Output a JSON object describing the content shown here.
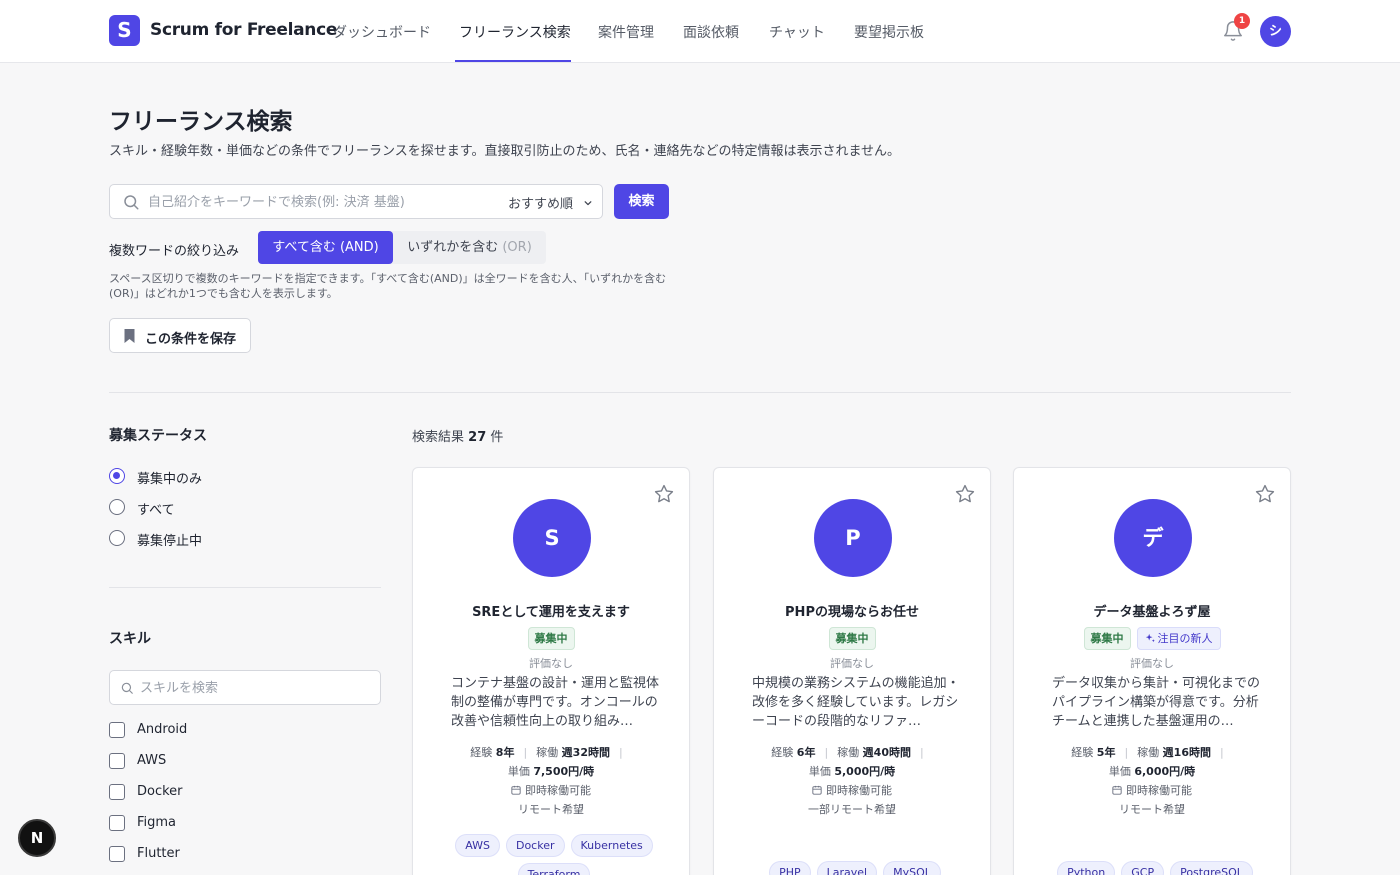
{
  "app": {
    "logo_letter": "S",
    "name": "Scrum for Freelance"
  },
  "nav": {
    "items": [
      {
        "label": "ダッシュボード"
      },
      {
        "label": "フリーランス検索"
      },
      {
        "label": "案件管理"
      },
      {
        "label": "面談依頼"
      },
      {
        "label": "チャット"
      },
      {
        "label": "要望掲示板"
      }
    ],
    "active": "フリーランス検索",
    "notification_count": "1",
    "user_initial": "シ"
  },
  "page": {
    "title": "フリーランス検索",
    "description": "スキル・経験年数・単価などの条件でフリーランスを探せます。直接取引防止のため、氏名・連絡先などの特定情報は表示されません。"
  },
  "search": {
    "placeholder": "自己紹介をキーワードで検索(例: 決済 基盤)",
    "value": "",
    "sort_selected": "おすすめ順",
    "button_label": "検索"
  },
  "multiword": {
    "label": "複数ワードの絞り込み",
    "and_label": "すべて含む (AND)",
    "or_main": "いずれかを含む",
    "or_suffix": "(OR)",
    "help": "スペース区切りで複数のキーワードを指定できます。「すべて含む(AND)」は全ワードを含む人、「いずれかを含む(OR)」はどれか1つでも含む人を表示します。",
    "save_label": "この条件を保存"
  },
  "filters": {
    "status_heading": "募集ステータス",
    "status_options": [
      {
        "label": "募集中のみ",
        "selected": true
      },
      {
        "label": "すべて",
        "selected": false
      },
      {
        "label": "募集停止中",
        "selected": false
      }
    ],
    "skill_heading": "スキル",
    "skill_search_placeholder": "スキルを検索",
    "skills": [
      {
        "label": "Android",
        "checked": false
      },
      {
        "label": "AWS",
        "checked": false
      },
      {
        "label": "Docker",
        "checked": false
      },
      {
        "label": "Figma",
        "checked": false
      },
      {
        "label": "Flutter",
        "checked": false
      }
    ]
  },
  "results": {
    "prefix": "検索結果",
    "count": "27",
    "suffix": "件"
  },
  "cards": [
    {
      "initial": "S",
      "title": "SREとして運用を支えます",
      "status_badge": "募集中",
      "new_badge": "",
      "rating": "評価なし",
      "bio": "コンテナ基盤の設計・運用と監視体制の整備が専門です。オンコールの改善や信頼性向上の取り組み…",
      "exp_label": "経験",
      "exp_value": "8年",
      "work_label": "稼働",
      "work_value": "週32時間",
      "rate_label": "単価",
      "rate_value": "7,500円/時",
      "availability": "即時稼働可能",
      "remote": "リモート希望",
      "tags": [
        "AWS",
        "Docker",
        "Kubernetes",
        "Terraform"
      ]
    },
    {
      "initial": "P",
      "title": "PHPの現場ならお任せ",
      "status_badge": "募集中",
      "new_badge": "",
      "rating": "評価なし",
      "bio": "中規模の業務システムの機能追加・改修を多く経験しています。レガシーコードの段階的なリファ…",
      "exp_label": "経験",
      "exp_value": "6年",
      "work_label": "稼働",
      "work_value": "週40時間",
      "rate_label": "単価",
      "rate_value": "5,000円/時",
      "availability": "即時稼働可能",
      "remote": "一部リモート希望",
      "tags": [
        "PHP",
        "Laravel",
        "MySQL"
      ]
    },
    {
      "initial": "デ",
      "title": "データ基盤よろず屋",
      "status_badge": "募集中",
      "new_badge": "注目の新人",
      "rating": "評価なし",
      "bio": "データ収集から集計・可視化までのパイプライン構築が得意です。分析チームと連携した基盤運用の…",
      "exp_label": "経験",
      "exp_value": "5年",
      "work_label": "稼働",
      "work_value": "週16時間",
      "rate_label": "単価",
      "rate_value": "6,000円/時",
      "availability": "即時稼働可能",
      "remote": "リモート希望",
      "tags": [
        "Python",
        "GCP",
        "PostgreSQL"
      ]
    }
  ],
  "dev_badge": "N",
  "colors": {
    "primary": "#4f46e5",
    "status_green": "#2f7a47",
    "danger": "#ef4444"
  }
}
